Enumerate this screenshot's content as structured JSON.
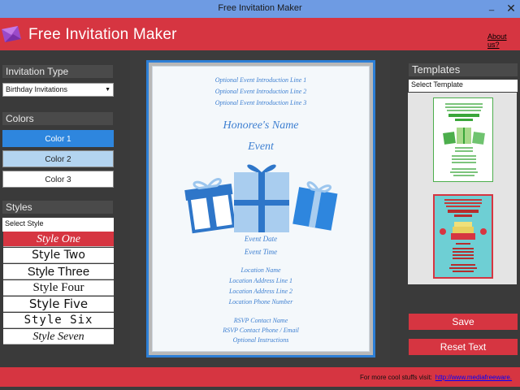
{
  "window": {
    "title": "Free Invitation Maker",
    "minimize": "_",
    "close": "✕"
  },
  "header": {
    "app_title": "Free Invitation Maker",
    "about_link": "About us?"
  },
  "left": {
    "invitation_type_label": "Invitation Type",
    "invitation_type_selected": "Birthday Invitations",
    "colors_label": "Colors",
    "colors": [
      {
        "label": "Color 1",
        "bg": "#2e86de",
        "fg": "#ffffff"
      },
      {
        "label": "Color 2",
        "bg": "#b3d4f0",
        "fg": "#222222"
      },
      {
        "label": "Color 3",
        "bg": "#ffffff",
        "fg": "#222222"
      }
    ],
    "styles_label": "Styles",
    "styles_select_placeholder": "Select Style",
    "styles": [
      "Style One",
      "Style Two",
      "Style Three",
      "Style Four",
      "Style Five",
      "Style Six",
      "Style Seven"
    ]
  },
  "card": {
    "intro_lines": [
      "Optional Event Introduction Line 1",
      "Optional Event Introduction Line 2",
      "Optional Event Introduction Line 3"
    ],
    "honoree": "Honoree's Name",
    "event": "Event",
    "event_date": "Event Date",
    "event_time": "Event Time",
    "location_name": "Location Name",
    "address_1": "Location Address Line 1",
    "address_2": "Location Address Line 2",
    "phone": "Location Phone Number",
    "rsvp_name": "RSVP Contact Name",
    "rsvp_phone": "RSVP Contact Phone / Email",
    "instructions": "Optional Instructions"
  },
  "right": {
    "templates_label": "Templates",
    "select_template_placeholder": "Select Template",
    "save_button": "Save",
    "reset_button": "Reset Text"
  },
  "footer": {
    "text": "For more cool stuffs visit:",
    "link": "http://www.mediafreeware."
  },
  "colors": {
    "accent_red": "#d63541",
    "titlebar_blue": "#6e9be3",
    "card_blue": "#3d7fd1"
  }
}
